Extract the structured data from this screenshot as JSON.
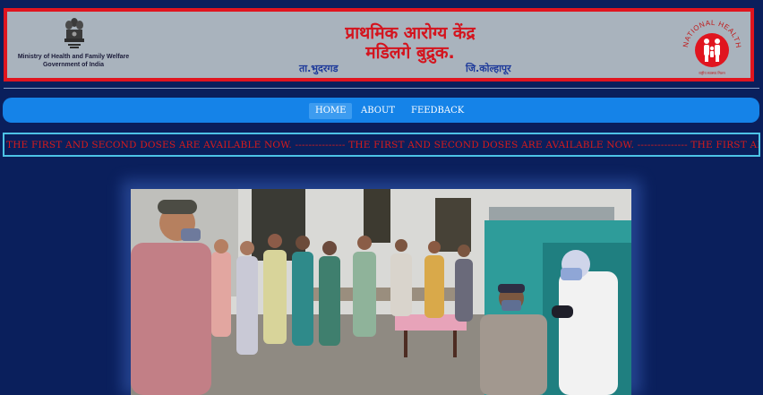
{
  "header": {
    "ministry_line1": "Ministry of Health and Family Welfare",
    "ministry_line2": "Government of India",
    "title_line1": "प्राथमिक आरोग्य केंद्र",
    "title_line2": "मडिलगे बुद्रुक.",
    "taluka": "ता.भुदरगड",
    "district": "जि.कोल्हापूर",
    "nhm_logo_text": "NATIONAL HEALTH MISSION",
    "nhm_logo_tagline": "राष्ट्रीय स्वास्थ्य मिशन"
  },
  "nav": {
    "items": [
      "HOME",
      "ABOUT",
      "FEEDBACK"
    ],
    "active": "HOME"
  },
  "announcement": {
    "text": "THE FIRST AND SECOND DOSES ARE AVAILABLE NOW. --------------- THE FIRST AND SECOND DOSES ARE AVAILABLE NOW. --------------- THE FIRST AND SECOND DOSES ARE AVAILABLE NOW."
  },
  "colors": {
    "page_bg": "#0a1f5c",
    "header_bg": "#a9b3bd",
    "header_border": "#e0151f",
    "title_red": "#d4141e",
    "nav_bg": "#1583e8",
    "marquee_text": "#d91b1b",
    "marquee_border": "#4dc3e6"
  },
  "icons": {
    "emblem": "ashoka-emblem-icon",
    "nhm": "nhm-logo-icon"
  }
}
